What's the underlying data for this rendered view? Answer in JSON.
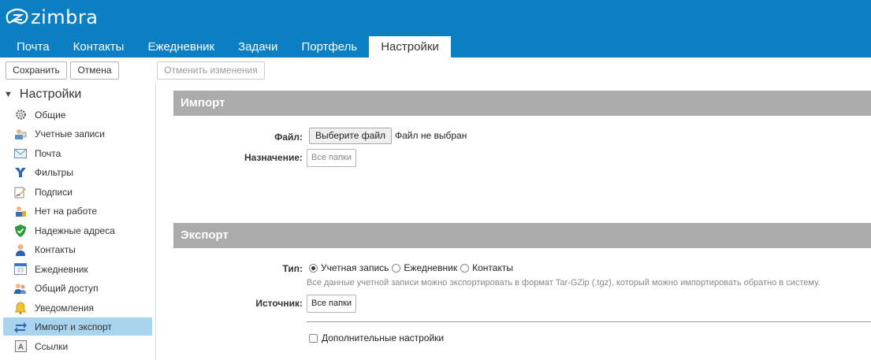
{
  "app": {
    "logo_text": "zimbra"
  },
  "tabs": [
    {
      "label": "Почта"
    },
    {
      "label": "Контакты"
    },
    {
      "label": "Ежедневник"
    },
    {
      "label": "Задачи"
    },
    {
      "label": "Портфель"
    },
    {
      "label": "Настройки",
      "active": true
    }
  ],
  "toolbar": {
    "save_label": "Сохранить",
    "cancel_label": "Отмена",
    "revert_label": "Отменить изменения"
  },
  "sidebar": {
    "title": "Настройки",
    "items": [
      {
        "label": "Общие",
        "icon": "gear-icon"
      },
      {
        "label": "Учетные записи",
        "icon": "accounts-icon"
      },
      {
        "label": "Почта",
        "icon": "mail-icon"
      },
      {
        "label": "Фильтры",
        "icon": "filter-icon"
      },
      {
        "label": "Подписи",
        "icon": "signature-icon"
      },
      {
        "label": "Нет на работе",
        "icon": "out-of-office-icon"
      },
      {
        "label": "Надежные адреса",
        "icon": "shield-icon"
      },
      {
        "label": "Контакты",
        "icon": "contact-icon"
      },
      {
        "label": "Ежедневник",
        "icon": "calendar-icon"
      },
      {
        "label": "Общий доступ",
        "icon": "sharing-icon"
      },
      {
        "label": "Уведомления",
        "icon": "bell-icon"
      },
      {
        "label": "Импорт и экспорт",
        "icon": "import-export-icon",
        "selected": true
      },
      {
        "label": "Ссылки",
        "icon": "shortcuts-icon"
      }
    ]
  },
  "import": {
    "title": "Импорт",
    "file_label": "Файл:",
    "file_button": "Выберите файл",
    "file_status": "Файл не выбран",
    "dest_label": "Назначение:",
    "dest_button": "Все папки"
  },
  "export": {
    "title": "Экспорт",
    "type_label": "Тип:",
    "types": [
      {
        "label": "Учетная запись",
        "checked": true
      },
      {
        "label": "Ежедневник",
        "checked": false
      },
      {
        "label": "Контакты",
        "checked": false
      }
    ],
    "hint": "Все данные учетной записи можно экспортировать в формат Tar-GZip (.tgz), который можно импортировать обратно в систему.",
    "source_label": "Источник:",
    "source_button": "Все папки",
    "advanced_label": "Дополнительные настройки"
  },
  "colors": {
    "header": "#0a7fc2",
    "section_bar": "#ababab",
    "selected_item": "#a9d4ee"
  }
}
